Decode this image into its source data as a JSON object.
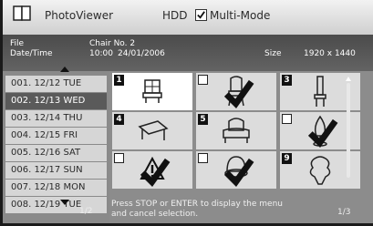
{
  "header": {
    "app_title": "PhotoViewer",
    "source": "HDD",
    "multimode_label": "Multi-Mode",
    "multimode_checked": true
  },
  "info": {
    "file_label": "File",
    "file_value": "Chair No. 2",
    "date_label": "Date/Time",
    "time_value": "10:00",
    "date_value": "24/01/2006",
    "size_label": "Size",
    "size_value": "1920 x 1440"
  },
  "date_list": {
    "items": [
      "001. 12/12 TUE",
      "002. 12/13 WED",
      "003. 12/14 THU",
      "004. 12/15 FRI",
      "005. 12/16 SAT",
      "006. 12/17 SUN",
      "007. 12/18 MON",
      "008. 12/19 TUE"
    ],
    "selected_index": 1,
    "page": "1/2"
  },
  "grid": {
    "thumbnails": [
      {
        "badge": "1",
        "marker": "number",
        "icon": "table-icon"
      },
      {
        "badge": "",
        "marker": "check",
        "icon": "chair-icon"
      },
      {
        "badge": "3",
        "marker": "number",
        "icon": "tall-chair-icon"
      },
      {
        "badge": "4",
        "marker": "number",
        "icon": "low-table-icon"
      },
      {
        "badge": "5",
        "marker": "number",
        "icon": "sofa-icon"
      },
      {
        "badge": "",
        "marker": "check",
        "icon": "vase-icon"
      },
      {
        "badge": "",
        "marker": "check",
        "icon": "warning-icon"
      },
      {
        "badge": "",
        "marker": "check",
        "icon": "round-chair-icon"
      },
      {
        "badge": "9",
        "marker": "number",
        "icon": "ornament-icon"
      }
    ],
    "selected_index": 0,
    "message_line1": "Press STOP or ENTER to display the menu",
    "message_line2": "and cancel selection.",
    "page": "1/3"
  }
}
